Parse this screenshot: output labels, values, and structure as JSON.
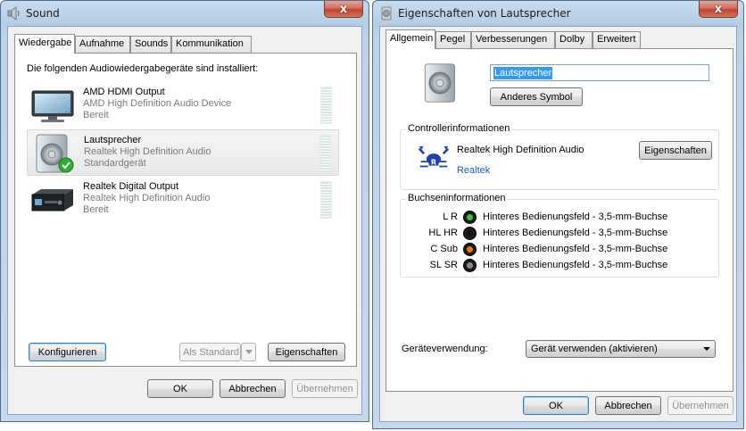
{
  "sound_window": {
    "title": "Sound",
    "close_glyph": "x",
    "tabs": [
      {
        "label": "Wiedergabe",
        "active": true
      },
      {
        "label": "Aufnahme",
        "active": false
      },
      {
        "label": "Sounds",
        "active": false
      },
      {
        "label": "Kommunikation",
        "active": false
      }
    ],
    "intro_text": "Die folgenden Audiowiedergabegeräte sind installiert:",
    "devices": [
      {
        "name": "AMD HDMI Output",
        "line1": "AMD High Definition Audio Device",
        "line2": "Bereit",
        "icon": "monitor-icon",
        "selected": false,
        "default": false
      },
      {
        "name": "Lautsprecher",
        "line1": "Realtek High Definition Audio",
        "line2": "Standardgerät",
        "icon": "speaker-icon",
        "selected": true,
        "default": true
      },
      {
        "name": "Realtek Digital Output",
        "line1": "Realtek High Definition Audio",
        "line2": "Bereit",
        "icon": "receiver-icon",
        "selected": false,
        "default": false
      }
    ],
    "buttons": {
      "configure": "Konfigurieren",
      "set_default": "Als Standard",
      "properties": "Eigenschaften",
      "ok": "OK",
      "cancel": "Abbrechen",
      "apply": "Übernehmen"
    }
  },
  "props_window": {
    "title": "Eigenschaften von Lautsprecher",
    "close_glyph": "x",
    "tabs": [
      {
        "label": "Allgemein",
        "active": true
      },
      {
        "label": "Pegel",
        "active": false
      },
      {
        "label": "Verbesserungen",
        "active": false
      },
      {
        "label": "Dolby",
        "active": false
      },
      {
        "label": "Erweitert",
        "active": false
      }
    ],
    "device_name_value": "Lautsprecher",
    "change_icon_button": "Anderes Symbol",
    "controller_group": {
      "label": "Controllerinformationen",
      "controller_name": "Realtek High Definition Audio",
      "vendor_link": "Realtek",
      "properties_button": "Eigenschaften"
    },
    "jack_group": {
      "label": "Buchseninformationen",
      "jacks": [
        {
          "channel": "L R",
          "color": "#3cc23c",
          "location": "Hinteres Bedienungsfeld - 3,5-mm-Buchse"
        },
        {
          "channel": "HL HR",
          "color": "#111111",
          "location": "Hinteres Bedienungsfeld - 3,5-mm-Buchse"
        },
        {
          "channel": "C Sub",
          "color": "#f07a12",
          "location": "Hinteres Bedienungsfeld - 3,5-mm-Buchse"
        },
        {
          "channel": "SL SR",
          "color": "#8a8a8a",
          "location": "Hinteres Bedienungsfeld - 3,5-mm-Buchse"
        }
      ]
    },
    "device_usage": {
      "label": "Geräteverwendung:",
      "selected": "Gerät verwenden (aktivieren)"
    },
    "buttons": {
      "ok": "OK",
      "cancel": "Abbrechen",
      "apply": "Übernehmen"
    }
  }
}
